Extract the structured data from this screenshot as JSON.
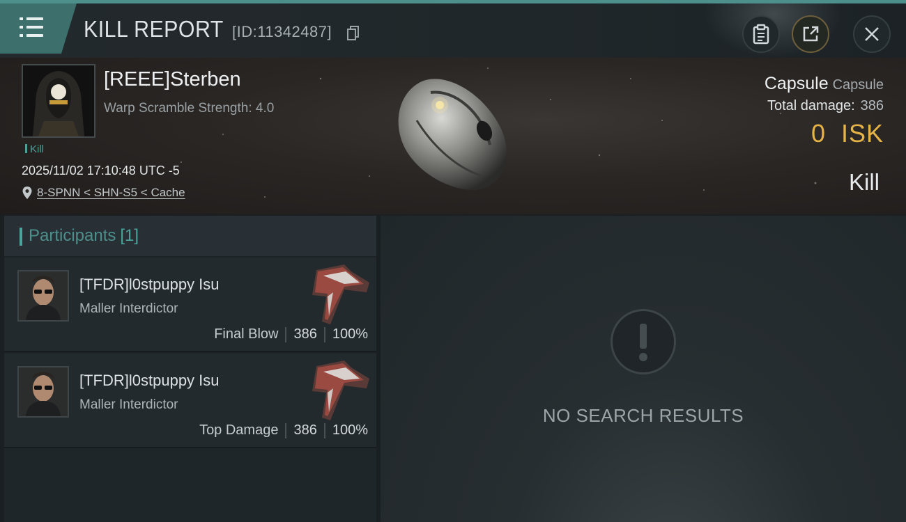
{
  "header": {
    "title": "KILL REPORT",
    "report_id": "[ID:11342487]",
    "menu_icon": "hamburger-menu-icon",
    "copy_icon": "copy-icon",
    "buttons": [
      {
        "name": "clipboard-icon"
      },
      {
        "name": "share-icon"
      },
      {
        "name": "close-icon"
      }
    ]
  },
  "victim": {
    "name": "[REEE]Sterben",
    "subtitle": "Warp Scramble Strength: 4.0",
    "kill_tag": "Kill",
    "timestamp": "2025/11/02 17:10:48 UTC -5",
    "location": "8-SPNN < SHN-S5 < Cache",
    "ship_name": "Capsule",
    "ship_type": "Capsule",
    "total_damage_label": "Total damage:",
    "total_damage": "386",
    "isk_value": "0",
    "isk_unit": "ISK",
    "result": "Kill"
  },
  "participants": {
    "label": "Participants",
    "count": "[1]",
    "rows": [
      {
        "name": "[TFDR]l0stpuppy Isu",
        "ship": "Maller Interdictor",
        "role": "Final Blow",
        "damage": "386",
        "percent": "100%"
      },
      {
        "name": "[TFDR]l0stpuppy Isu",
        "ship": "Maller Interdictor",
        "role": "Top Damage",
        "damage": "386",
        "percent": "100%"
      }
    ]
  },
  "results_panel": {
    "empty_text": "NO SEARCH RESULTS",
    "icon": "exclamation-icon"
  },
  "colors": {
    "accent": "#4ba39c",
    "isk": "#e6b446",
    "header_teal": "#3d6f6d"
  }
}
